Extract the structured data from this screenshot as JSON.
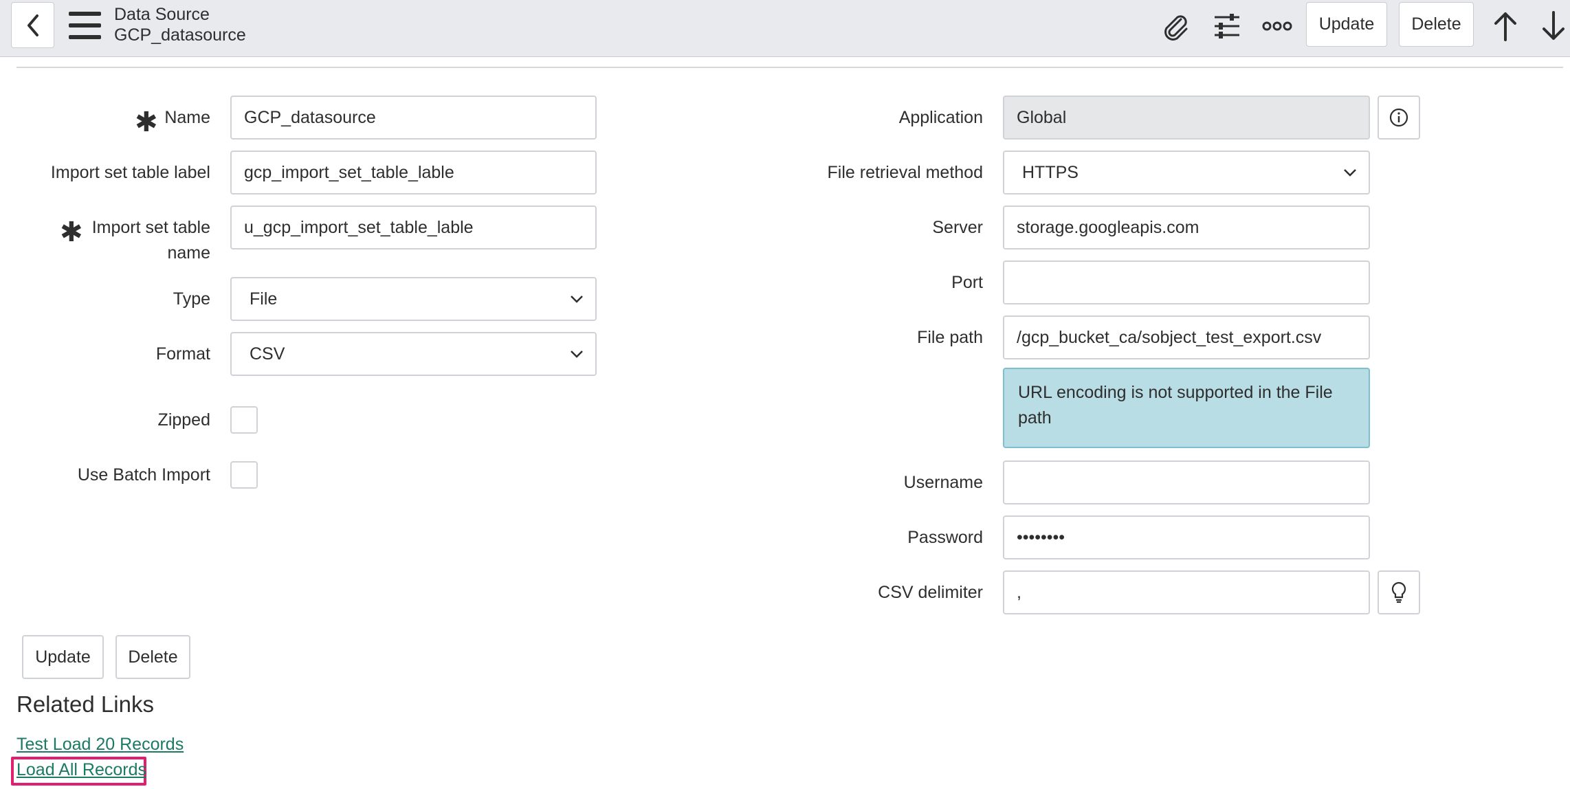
{
  "header": {
    "title": "Data Source",
    "subtitle": "GCP_datasource",
    "update_label": "Update",
    "delete_label": "Delete"
  },
  "form_left": {
    "name": {
      "label": "Name",
      "value": "GCP_datasource",
      "required": true
    },
    "import_label": {
      "label": "Import set table label",
      "value": "gcp_import_set_table_lable"
    },
    "import_name": {
      "label_line1": "Import set table",
      "label_line2": "name",
      "value": "u_gcp_import_set_table_lable",
      "required": true
    },
    "type": {
      "label": "Type",
      "value": "File"
    },
    "format": {
      "label": "Format",
      "value": "CSV"
    },
    "zipped": {
      "label": "Zipped",
      "checked": false
    },
    "batch": {
      "label": "Use Batch Import",
      "checked": false
    }
  },
  "form_right": {
    "application": {
      "label": "Application",
      "value": "Global"
    },
    "retrieval": {
      "label": "File retrieval method",
      "value": "HTTPS"
    },
    "server": {
      "label": "Server",
      "value": "storage.googleapis.com"
    },
    "port": {
      "label": "Port",
      "value": ""
    },
    "file_path": {
      "label": "File path",
      "value": "/gcp_bucket_ca/sobject_test_export.csv"
    },
    "file_path_note": "URL encoding is not supported in the File path",
    "username": {
      "label": "Username",
      "value": ""
    },
    "password": {
      "label": "Password",
      "value": "••••••••"
    },
    "csv_delimiter": {
      "label": "CSV delimiter",
      "value": ","
    }
  },
  "actions": {
    "update_label": "Update",
    "delete_label": "Delete"
  },
  "related": {
    "title": "Related Links",
    "links": [
      "Test Load 20 Records",
      "Load All Records"
    ]
  },
  "colors": {
    "header_bg": "#e9eaed",
    "info_bg": "#b8dde4",
    "link": "#1b7a63",
    "highlight": "#e0206f"
  }
}
